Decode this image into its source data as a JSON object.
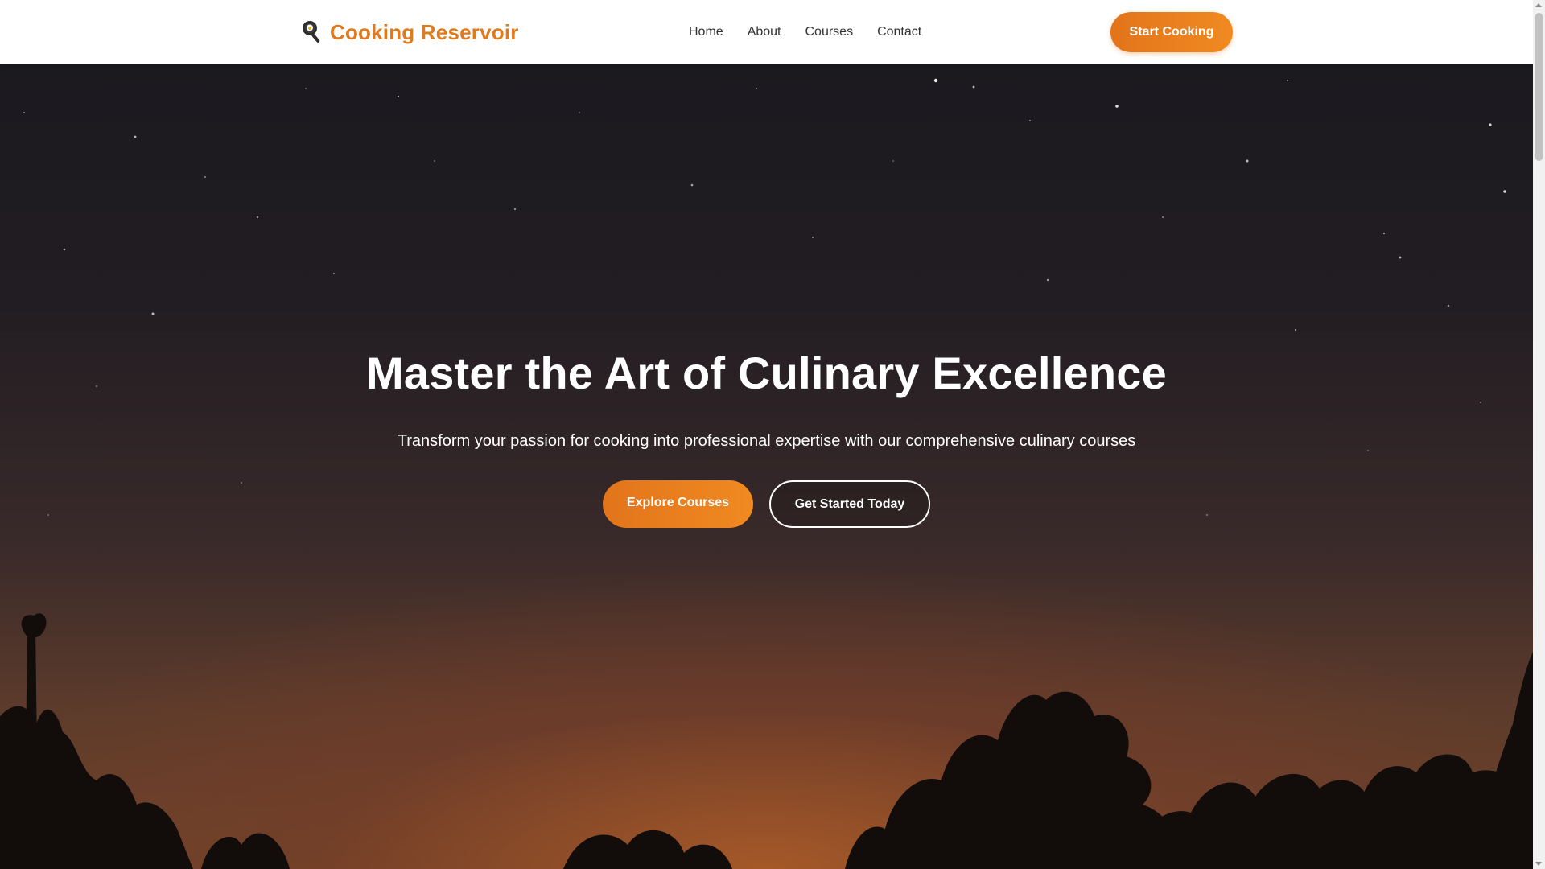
{
  "header": {
    "brand": "Cooking Reservoir",
    "brand_icon": "frying-pan-icon",
    "nav": [
      {
        "label": "Home"
      },
      {
        "label": "About"
      },
      {
        "label": "Courses"
      },
      {
        "label": "Contact"
      }
    ],
    "cta_label": "Start Cooking"
  },
  "hero": {
    "title": "Master the Art of Culinary Excellence",
    "subtitle": "Transform your passion for cooking into professional expertise with our comprehensive culinary courses",
    "primary_button": "Explore Courses",
    "secondary_button": "Get Started Today"
  },
  "colors": {
    "accent": "#e2741b",
    "accent_light": "#f08a20",
    "brand_text": "#e07a1f",
    "nav_text": "#333333",
    "hero_text": "#ffffff"
  }
}
